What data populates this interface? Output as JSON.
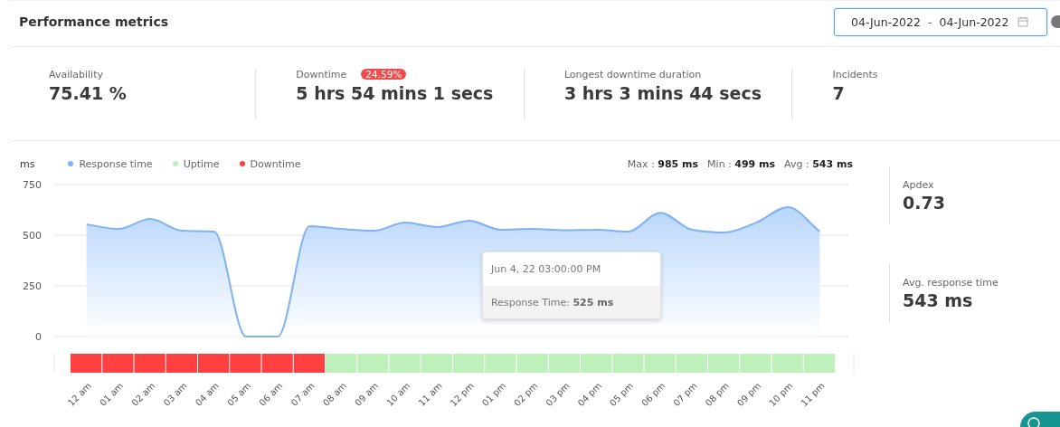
{
  "header": {
    "title": "Performance metrics",
    "date_range": {
      "start": "04-Jun-2022",
      "separator": "-",
      "end": "04-Jun-2022"
    }
  },
  "stats": [
    {
      "label": "Availability",
      "value": "75.41 %"
    },
    {
      "label": "Downtime",
      "badge": "24.59%",
      "value": "5 hrs 54 mins 1 secs"
    },
    {
      "label": "Longest downtime duration",
      "value": "3 hrs 3 mins 44 secs"
    },
    {
      "label": "Incidents",
      "value": "7"
    }
  ],
  "chart": {
    "unit": "ms",
    "legend": [
      {
        "label": "Uptime",
        "color": "#bdf0bb"
      },
      {
        "label": "Downtime",
        "color": "#ff4040"
      }
    ],
    "summary": [
      {
        "label": "Max :",
        "value": "985 ms"
      },
      {
        "label": "Min :",
        "value": "499 ms"
      },
      {
        "label": "Avg :",
        "value": "543 ms"
      }
    ],
    "chart_data": {
      "type": "area",
      "categories": [
        "12 am",
        "01 am",
        "02 am",
        "03 am",
        "04 am",
        "05 am",
        "06 am",
        "07 am",
        "08 am",
        "09 am",
        "10 am",
        "11 am",
        "12 pm",
        "01 pm",
        "02 pm",
        "03 pm",
        "04 pm",
        "05 pm",
        "06 pm",
        "07 pm",
        "08 pm",
        "09 pm",
        "10 pm",
        "11 pm"
      ],
      "series": [
        {
          "name": "Response time",
          "color": "#7eb2f4",
          "values": [
            553,
            531,
            580,
            522,
            518,
            0,
            0,
            545,
            531,
            522,
            562,
            540,
            571,
            527,
            531,
            525,
            527,
            518,
            611,
            527,
            513,
            562,
            638,
            518
          ]
        }
      ],
      "ylim": [
        0,
        750
      ],
      "yticks": [
        0,
        250,
        500,
        750
      ]
    },
    "status": [
      {
        "kind": "down"
      },
      {
        "kind": "down"
      },
      {
        "kind": "down"
      },
      {
        "kind": "down"
      },
      {
        "kind": "down"
      },
      {
        "kind": "down"
      },
      {
        "kind": "down"
      },
      {
        "kind": "down"
      },
      {
        "kind": "up"
      },
      {
        "kind": "up"
      },
      {
        "kind": "up"
      },
      {
        "kind": "up"
      },
      {
        "kind": "up"
      },
      {
        "kind": "up"
      },
      {
        "kind": "up"
      },
      {
        "kind": "up"
      },
      {
        "kind": "up"
      },
      {
        "kind": "up"
      },
      {
        "kind": "up"
      },
      {
        "kind": "up"
      },
      {
        "kind": "up"
      },
      {
        "kind": "up"
      },
      {
        "kind": "up"
      },
      {
        "kind": "up"
      }
    ],
    "tooltip": {
      "title": "Jun 4, 22 03:00:00 PM",
      "label": "Response Time:",
      "value": "525 ms"
    }
  },
  "side_stats": [
    {
      "label": "Apdex",
      "value": "0.73"
    },
    {
      "label": "Avg. response time",
      "value": "543 ms"
    }
  ]
}
